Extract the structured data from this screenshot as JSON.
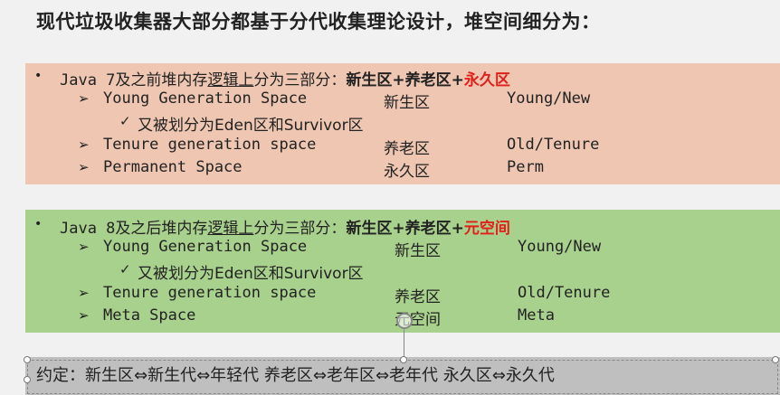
{
  "title": "现代垃圾收集器大部分都基于分代收集理论设计，堆空间细分为：",
  "java7": {
    "bullet_prefix": "Java 7及之前堆内存",
    "bullet_underline": "逻辑上",
    "bullet_mid": "分为三部分：",
    "bullet_bold": "新生区+养老区+",
    "bullet_red": "永久区",
    "rows": [
      {
        "name": "Young Generation Space",
        "cn": "新生区",
        "en": "Young/New"
      },
      {
        "name": "Tenure generation space",
        "cn": "养老区",
        "en": "Old/Tenure"
      },
      {
        "name": "Permanent Space",
        "cn": "永久区",
        "en": "Perm"
      }
    ],
    "sub": "又被划分为Eden区和Survivor区"
  },
  "java8": {
    "bullet_prefix": "Java 8及之后堆内存",
    "bullet_underline": "逻辑上",
    "bullet_mid": "分为三部分：",
    "bullet_bold": "新生区+养老区+",
    "bullet_red": "元空间",
    "rows": [
      {
        "name": "Young Generation Space",
        "cn": "新生区",
        "en": "Young/New"
      },
      {
        "name": "Tenure generation space",
        "cn": "养老区",
        "en": "Old/Tenure"
      },
      {
        "name": "Meta Space",
        "cn": "元空间",
        "en": "Meta"
      }
    ],
    "sub": "又被划分为Eden区和Survivor区"
  },
  "convention": "约定：新生区⇔新生代⇔年轻代    养老区⇔老年区⇔老年代    永久区⇔永久代",
  "colors": {
    "java7_bg": "#eec6b1",
    "java8_bg": "#a9d18e",
    "accent_red": "#e0201a",
    "bar_bg": "#bfbfbf"
  }
}
